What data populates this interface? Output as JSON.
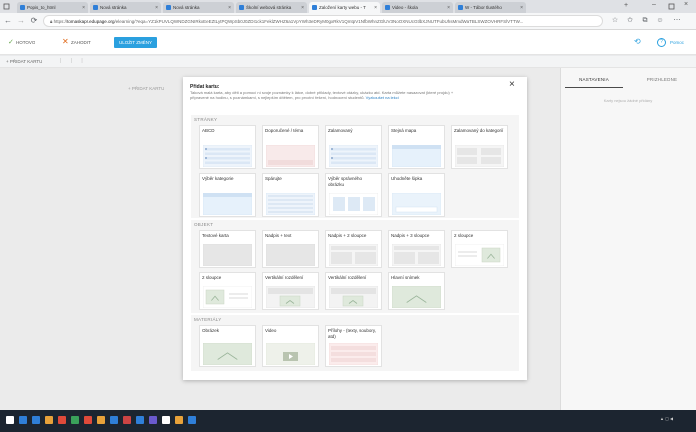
{
  "browser": {
    "tabs": [
      {
        "label": "Popis_to_html"
      },
      {
        "label": "Nová stránka"
      },
      {
        "label": "Nová stránka"
      },
      {
        "label": "Školní webová stránka"
      },
      {
        "label": "Založení karty webu - T"
      },
      {
        "label": "Video - škola"
      },
      {
        "label": "W - Tábor tlustého"
      }
    ],
    "active_tab_index": 4,
    "url_prefix": "https://",
    "url_host": "tomaskapr.edupage.org",
    "url_rest": "/elearning/?eqa=YZ1kPUVLQWNDZGNIRkxEeEZtLytPQWpSb0J0ZDI1ck1FeklZWHZ6a1VpYWh3eDRyM0gxRkV1QmtpV1NfbWhnZGlUV3NoOXNUcGtlbXJNUTFubUhsMmdWaTBLSWZOVHRFSlVTTW..."
  },
  "app": {
    "undo_label": "HOTOVO",
    "discard_label": "ZAHODIT",
    "save_label": "ULOŽIT ZMĚNY",
    "help_label": "Pomoc",
    "add_card_label": "PŘIDAT KARTU",
    "canvas_add_card": "+ PŘIDAT KARTU"
  },
  "right_panel": {
    "tab_settings": "NASTAVENIA",
    "tab_preview": "PRIZHLEDNE",
    "hint": "Karty nejsou žádné přidány"
  },
  "dialog": {
    "title": "Přidat kartu:",
    "description": "Taková malá karta, aby děti a pomocí ní svoje poznámky k látce, dobré příklady, textové otázky, ukázku atd. Karta můžete nasazovat (které projdu) + připravené na hodinu, s poznámkami, s nejlepším dítětem, pro prvotní řešení, hodnocení studentů.",
    "link": "Vyzkoušet na lekci",
    "close": "×",
    "sections": [
      {
        "title": "STRÁNKY",
        "cards": [
          {
            "label": "ABCD",
            "thumb": "rows"
          },
          {
            "label": "Doporučené / téma",
            "thumb": "pink"
          },
          {
            "label": "Zalamovaný",
            "thumb": "rows"
          },
          {
            "label": "Stejná mapa",
            "thumb": "blue"
          },
          {
            "label": "Zalamovaný do kategorií",
            "thumb": "grid"
          },
          {
            "label": "Výběr kategorie",
            "thumb": "blue"
          },
          {
            "label": "Spárujte",
            "thumb": "lines"
          },
          {
            "label": "Výběr správného obrázku",
            "thumb": "blocks"
          },
          {
            "label": "Uhodněte šipka",
            "thumb": "lightblue"
          }
        ]
      },
      {
        "title": "OBJEKT",
        "cards": [
          {
            "label": "Textové karta",
            "thumb": "plain"
          },
          {
            "label": "Nadpis + text",
            "thumb": "plain"
          },
          {
            "label": "Nadpis + 2 sloupce",
            "thumb": "twocol"
          },
          {
            "label": "Nadpis + 3 sloupce",
            "thumb": "twocol"
          },
          {
            "label": "2 sloupce",
            "thumb": "imgright"
          },
          {
            "label": "2 sloupce",
            "thumb": "imgleft"
          },
          {
            "label": "Vertikální rozdělení",
            "thumb": "vsplit"
          },
          {
            "label": "Vertikální rozdělení",
            "thumb": "vsplit"
          },
          {
            "label": "Hlavní snímek",
            "thumb": "image"
          }
        ]
      },
      {
        "title": "MATERIÁLY",
        "cards": [
          {
            "label": "Obrázek",
            "thumb": "image"
          },
          {
            "label": "Video",
            "thumb": "video"
          },
          {
            "label": "Přílohy - (texty, soubory, atd)",
            "thumb": "attach"
          }
        ]
      }
    ]
  },
  "taskbar": {
    "colors": [
      "#ffffff",
      "#2f7fd8",
      "#2f7fd8",
      "#e8a23a",
      "#e04a3a",
      "#3aa05a",
      "#e04a3a",
      "#e8a23a",
      "#2f7fd8",
      "#c44",
      "#2f7fd8",
      "#6a5acd",
      "#ffffff",
      "#e8a23a",
      "#2f7fd8"
    ]
  }
}
